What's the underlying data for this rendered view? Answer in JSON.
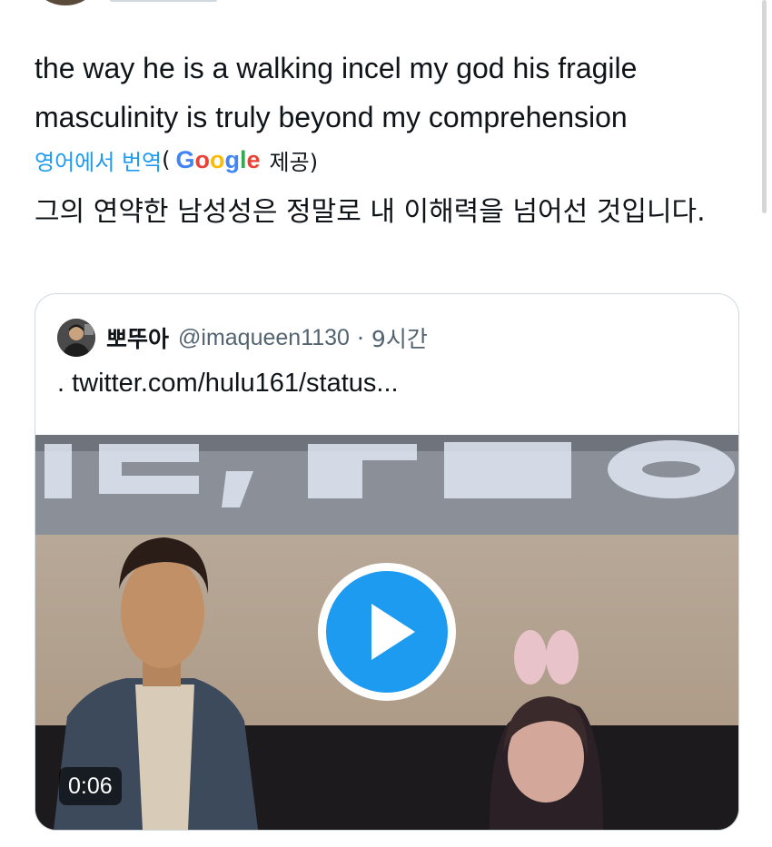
{
  "tweet": {
    "text": "the way he is a walking incel my god his fragile masculinity is truly beyond my comprehension",
    "translate_label": "영어에서 번역",
    "translate_open_paren": "(",
    "provider_prefix": "",
    "provider_letters": [
      "G",
      "o",
      "o",
      "g",
      "l",
      "e"
    ],
    "provider_suffix": "제공)",
    "translated_text": "그의 연약한 남성성은 정말로 내 이해력을 넘어선 것입니다."
  },
  "quote": {
    "author_name": "뽀뚜아",
    "author_handle": "@imaqueen1130",
    "separator": "·",
    "time": "9시간",
    "body": ". twitter.com/hulu161/status...",
    "video": {
      "duration": "0:06",
      "play_icon": "play-icon"
    }
  },
  "colors": {
    "accent": "#1d9bf0",
    "text": "#0f1419",
    "secondary": "#536471",
    "border": "#cfd9de"
  }
}
